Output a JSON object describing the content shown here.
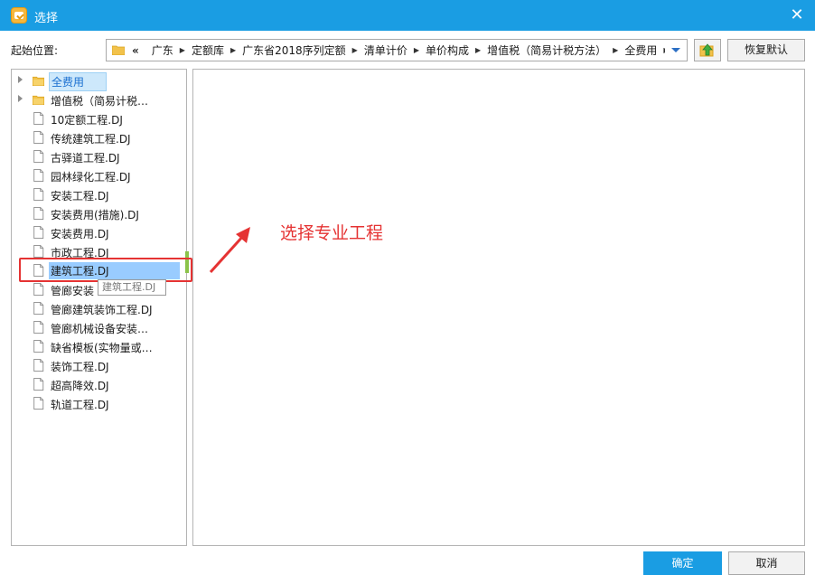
{
  "window": {
    "title": "选择",
    "close_glyph": "✕"
  },
  "toolbar": {
    "start_label": "起始位置:",
    "back_glyph": "«",
    "breadcrumbs": [
      "广东",
      "定额库",
      "广东省2018序列定额",
      "清单计价",
      "单价构成",
      "增值税（简易计税方法）",
      "全费用"
    ],
    "restore_label": "恢复默认"
  },
  "tree": {
    "items": [
      {
        "label": "全费用",
        "type": "folder",
        "expandable": true
      },
      {
        "label": "增值税（简易计税…",
        "type": "folder",
        "expandable": true
      },
      {
        "label": "10定额工程.DJ",
        "type": "file"
      },
      {
        "label": "传统建筑工程.DJ",
        "type": "file"
      },
      {
        "label": "古驿道工程.DJ",
        "type": "file"
      },
      {
        "label": "园林绿化工程.DJ",
        "type": "file"
      },
      {
        "label": "安装工程.DJ",
        "type": "file"
      },
      {
        "label": "安装费用(措施).DJ",
        "type": "file"
      },
      {
        "label": "安装费用.DJ",
        "type": "file"
      },
      {
        "label": "市政工程.DJ",
        "type": "file"
      },
      {
        "label": "建筑工程.DJ",
        "type": "file"
      },
      {
        "label": "管廊安装",
        "type": "file"
      },
      {
        "label": "管廊建筑装饰工程.DJ",
        "type": "file"
      },
      {
        "label": "管廊机械设备安装…",
        "type": "file"
      },
      {
        "label": "缺省模板(实物量或…",
        "type": "file"
      },
      {
        "label": "装饰工程.DJ",
        "type": "file"
      },
      {
        "label": "超高降效.DJ",
        "type": "file"
      },
      {
        "label": "轨道工程.DJ",
        "type": "file"
      }
    ],
    "selected_folder_index": 0,
    "selected_file_index": 10,
    "tooltip": "建筑工程.DJ"
  },
  "annotation": {
    "text": "选择专业工程",
    "color": "#e53333"
  },
  "footer": {
    "ok_label": "确定",
    "cancel_label": "取消"
  },
  "colors": {
    "accent": "#1a9de3",
    "selection": "#99ccff",
    "annotation_red": "#e53333"
  }
}
